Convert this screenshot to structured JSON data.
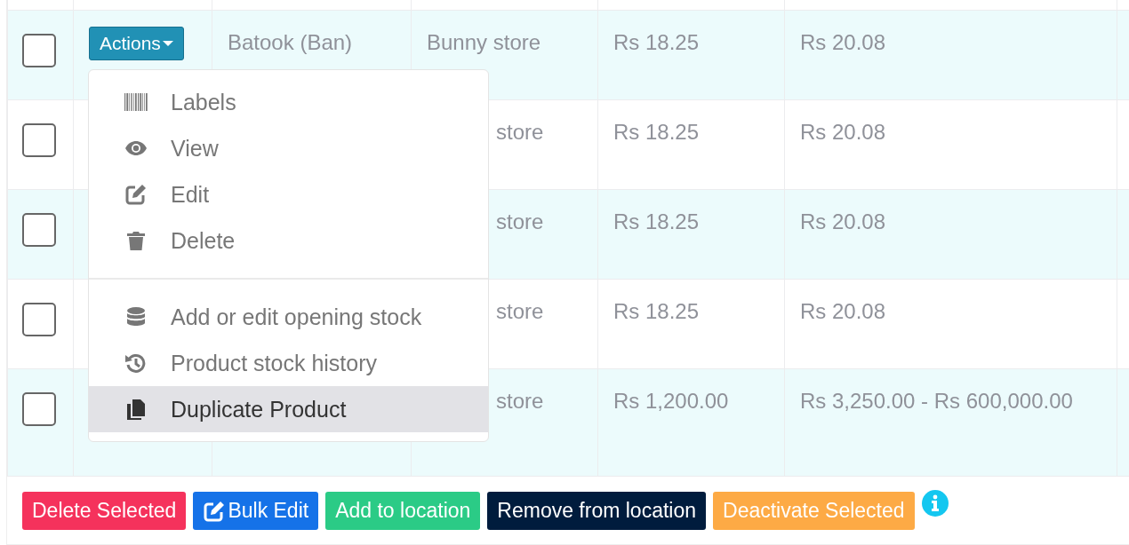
{
  "table": {
    "rows": [
      {
        "checked": false,
        "name": "Batook (Ban)",
        "location": "Bunny store",
        "price": "Rs 18.25",
        "selling_price": "Rs 20.08",
        "actions": "Actions"
      },
      {
        "checked": false,
        "location": "store",
        "price": "Rs 18.25",
        "selling_price": "Rs 20.08"
      },
      {
        "checked": false,
        "location": "store",
        "price": "Rs 18.25",
        "selling_price": "Rs 20.08"
      },
      {
        "checked": false,
        "location": "store",
        "price": "Rs 18.25",
        "selling_price": "Rs 20.08"
      },
      {
        "checked": false,
        "location": "store",
        "price": "Rs 1,200.00",
        "selling_price": "Rs 3,250.00 - Rs 600,000.00"
      }
    ]
  },
  "actions_menu": {
    "groups": [
      [
        {
          "label": "Labels",
          "selected": false
        },
        {
          "label": "View",
          "selected": false
        },
        {
          "label": "Edit",
          "selected": false
        },
        {
          "label": "Delete",
          "selected": false
        }
      ],
      [
        {
          "label": "Add or edit opening stock",
          "selected": false
        },
        {
          "label": "Product stock history",
          "selected": false
        },
        {
          "label": "Duplicate Product",
          "selected": true
        }
      ]
    ]
  },
  "bulk_buttons": [
    {
      "label": "Delete Selected",
      "color": "#f5325c"
    },
    {
      "label": "Bulk Edit",
      "color": "#1572e8"
    },
    {
      "label": "Add to location",
      "color": "#2bcb86"
    },
    {
      "label": "Remove from location",
      "color": "#001c3d"
    },
    {
      "label": "Deactivate Selected",
      "color": "#fdaa45"
    }
  ]
}
